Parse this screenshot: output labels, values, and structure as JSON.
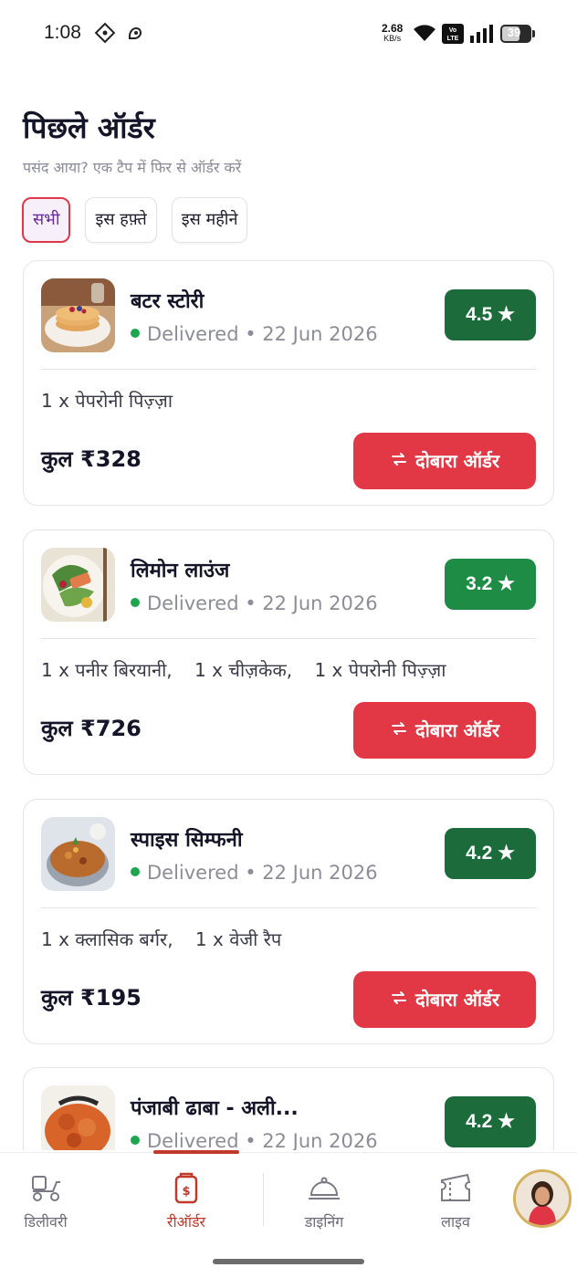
{
  "status_bar": {
    "time": "1:08",
    "net_speed": "2.68",
    "net_unit": "KB/s",
    "volte": "Vo LTE",
    "battery": "39"
  },
  "header": {
    "title": "पिछले ऑर्डर",
    "subtitle": "पसंद आया? एक टैप में फिर से ऑर्डर करें"
  },
  "filters": [
    {
      "label": "सभी",
      "active": true
    },
    {
      "label": "इस हफ़्ते",
      "active": false
    },
    {
      "label": "इस महीने",
      "active": false
    }
  ],
  "orders": [
    {
      "restaurant": "बटर स्टोरी",
      "status": "Delivered",
      "date": "22 Jun 2026",
      "rating": "4.5 ★",
      "items": [
        "1 x पेपरोनी पिज़्ज़ा"
      ],
      "total": "कुल ₹328",
      "reorder_label": "दोबारा ऑर्डर"
    },
    {
      "restaurant": "लिमोन लाउंज",
      "status": "Delivered",
      "date": "22 Jun 2026",
      "rating": "3.2 ★",
      "items": [
        "1 x पनीर बिरयानी,",
        "1 x चीज़केक,",
        "1 x पेपरोनी पिज़्ज़ा"
      ],
      "total": "कुल ₹726",
      "reorder_label": "दोबारा ऑर्डर"
    },
    {
      "restaurant": "स्पाइस सिम्फनी",
      "status": "Delivered",
      "date": "22 Jun 2026",
      "rating": "4.2 ★",
      "items": [
        "1 x क्लासिक बर्गर,",
        "1 x वेजी रैप"
      ],
      "total": "कुल ₹195",
      "reorder_label": "दोबारा ऑर्डर"
    },
    {
      "restaurant": "पंजाबी ढाबा - अली...",
      "status": "Delivered",
      "date": "22 Jun 2026",
      "rating": "4.2 ★"
    }
  ],
  "bottom_nav": [
    {
      "label": "डिलीवरी",
      "icon": "scooter-icon"
    },
    {
      "label": "रीऑर्डर",
      "icon": "reorder-bag-icon",
      "active": true
    },
    {
      "label": "डाइनिंग",
      "icon": "cloche-icon"
    },
    {
      "label": "लाइव",
      "icon": "ticket-icon"
    }
  ],
  "colors": {
    "accent_red": "#e23744",
    "rating_dark_green": "#1c6b3b",
    "rating_green": "#1e8c45",
    "active_chip_text": "#6a2aa0"
  }
}
